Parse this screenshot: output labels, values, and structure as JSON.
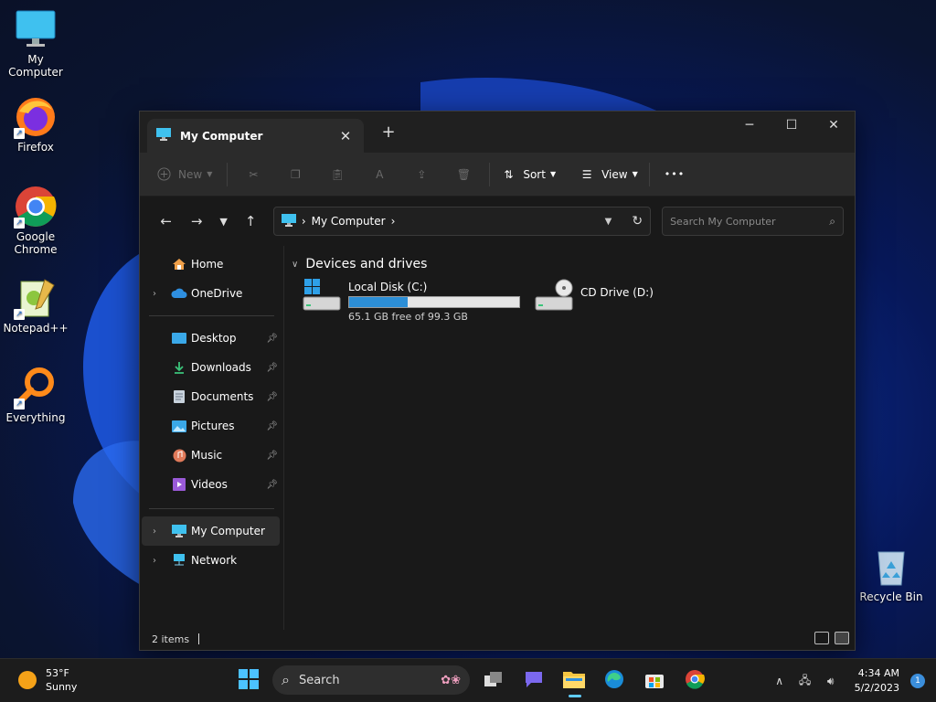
{
  "desktop": {
    "icons": [
      {
        "label": "My Computer"
      },
      {
        "label": "Firefox"
      },
      {
        "label": "Google Chrome"
      },
      {
        "label": "Notepad++"
      },
      {
        "label": "Everything"
      },
      {
        "label": "Recycle Bin"
      }
    ]
  },
  "window": {
    "tab_title": "My Computer",
    "close_tab": "✕",
    "new_tab": "+",
    "toolbar": {
      "new_label": "New",
      "sort_label": "Sort",
      "view_label": "View",
      "more_label": "•••"
    },
    "address": {
      "path": "My Computer",
      "search_placeholder": "Search My Computer"
    },
    "nav": {
      "home": "Home",
      "onedrive": "OneDrive",
      "pinned": [
        "Desktop",
        "Downloads",
        "Documents",
        "Pictures",
        "Music",
        "Videos"
      ],
      "my_computer": "My Computer",
      "network": "Network"
    },
    "content": {
      "group_title": "Devices and drives",
      "drives": [
        {
          "name": "Local Disk (C:)",
          "free_text": "65.1 GB free of 99.3 GB",
          "used_fraction": 0.344
        },
        {
          "name": "CD Drive (D:)"
        }
      ]
    },
    "status": {
      "items": "2 items"
    }
  },
  "taskbar": {
    "weather_temp": "53°F",
    "weather_desc": "Sunny",
    "search_label": "Search",
    "time": "4:34 AM",
    "date": "5/2/2023",
    "notifications": "1"
  },
  "colors": {
    "accent": "#60cdff",
    "drive_bar": "#2c8ed6"
  }
}
